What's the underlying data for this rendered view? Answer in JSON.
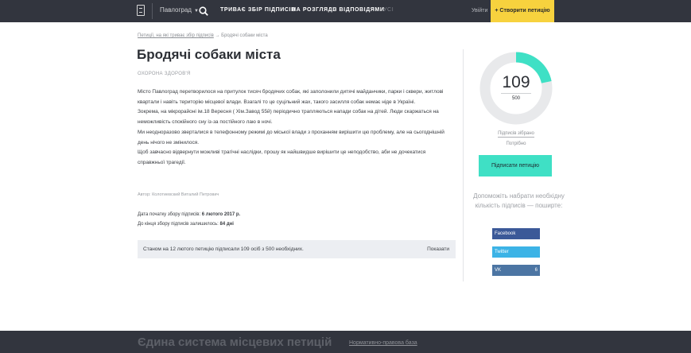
{
  "header": {
    "city": "Павлоград",
    "nav": [
      "ТРИВАЄ ЗБІР ПІДПИСІВ",
      "НА РОЗГЛЯДІ",
      "З ВІДПОВІДЯМИ",
      "УСІ"
    ],
    "login": "Увійти",
    "create_petition": "+ Створити петицію"
  },
  "breadcrumb": {
    "link": "Петиції, на які триває збір підписів",
    "sep": "→",
    "current": "Бродячі собаки міста"
  },
  "petition": {
    "title": "Бродячі собаки міста",
    "category": "ОХОРОНА ЗДОРОВ'Я",
    "paragraphs": [
      "Місто Павлоград перетворилося на притулок тисяч бродячих собак, які заполонили дитячі майданчики, парки і сквери, житлові квартали і навіть територію місцевої влади. Взагалі то це суцільний жах, такого засилля собак немає ніде в Україні.",
      "Зокрема, на мікрорайоні ім.18 Вересня ( Хім.Завод 55й) періодично трапляються напади собак на дітей. Люди скаржаться на неможливість спокійного сну із-за постійного лаю в ночі.",
      "Ми неодноразово зверталися в телефонному режимі до міської влади з проханням вирішити цю проблему, але на сьогоднішній день нічого не змінилося.",
      "Щоб завчасно відвернути можливі трагічні наслідки, прошу як найшвидше вирішити це неподобство, аби не дочекатися справжньої трагедії."
    ],
    "author": "Автор: Колотиевский Виталий Петрович",
    "start_label": "Дата початку збору підписів:",
    "start_value": "6 лютого 2017 р.",
    "left_label": "До кінця збору підписів залишилось:",
    "left_value": "84 дні",
    "summary": "Станом на 12 лютого петицію підписали 109 осіб з 500 необхідних.",
    "show_link": "Показати"
  },
  "progress": {
    "signed": 109,
    "needed": 500,
    "signed_label": "Підписів зібрано",
    "needed_label": "Потрібно",
    "ring_color": "#3fe0c5",
    "track_color": "#e8e9eb"
  },
  "sign_button": "Підписати петицію",
  "share": {
    "text": "Допоможіть набрати необхідну кількість підписів — поширте:",
    "facebook": "Facebook",
    "twitter": "Twitter",
    "vk": "VK",
    "vk_count": "6"
  },
  "footer": {
    "title": "Єдина система місцевих петицій",
    "link": "Нормативно-правова база"
  }
}
